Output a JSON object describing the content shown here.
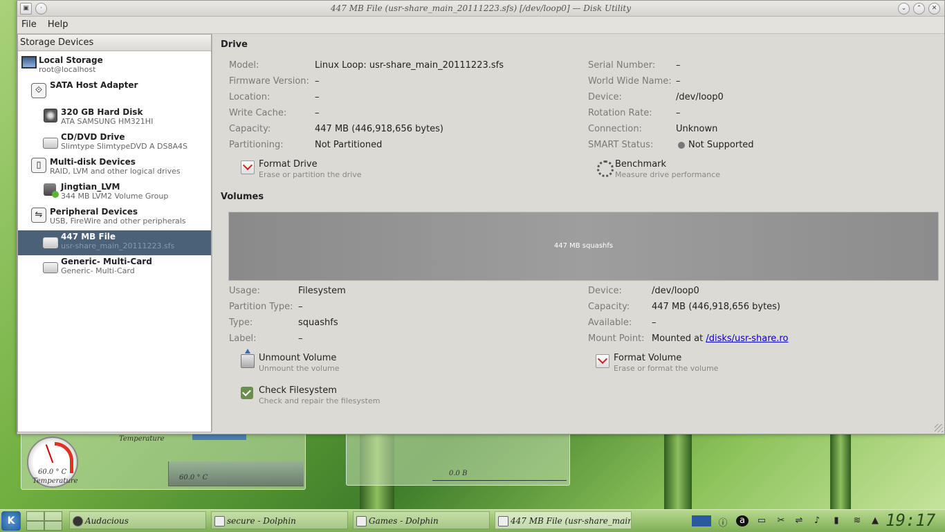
{
  "window": {
    "title": "447 MB File (usr-share_main_20111223.sfs) [/dev/loop0] — Disk Utility"
  },
  "menu": {
    "file": "File",
    "help": "Help"
  },
  "sidebar": {
    "header": "Storage Devices",
    "items": [
      {
        "title": "Local Storage",
        "sub": "root@localhost",
        "icon": "computer-icon"
      },
      {
        "title": "SATA Host Adapter",
        "sub": "",
        "icon": "sata-adapter-icon"
      },
      {
        "title": "320 GB Hard Disk",
        "sub": "ATA SAMSUNG HM321HI",
        "icon": "hard-disk-icon"
      },
      {
        "title": "CD/DVD Drive",
        "sub": "Slimtype SlimtypeDVD A DS8A4S",
        "icon": "optical-drive-icon"
      },
      {
        "title": "Multi-disk Devices",
        "sub": "RAID, LVM and other logical drives",
        "icon": "multidisk-icon"
      },
      {
        "title": "Jingtian_LVM",
        "sub": "344 MB LVM2 Volume Group",
        "icon": "lvm-icon"
      },
      {
        "title": "Peripheral Devices",
        "sub": "USB, FireWire and other peripherals",
        "icon": "usb-icon"
      },
      {
        "title": "447 MB File",
        "sub": "usr-share_main_20111223.sfs",
        "icon": "file-disk-icon",
        "selected": true
      },
      {
        "title": "Generic- Multi-Card",
        "sub": "Generic- Multi-Card",
        "icon": "card-reader-icon"
      }
    ]
  },
  "drive": {
    "heading": "Drive",
    "left": [
      {
        "label": "Model:",
        "value": "Linux Loop: usr-share_main_20111223.sfs"
      },
      {
        "label": "Firmware Version:",
        "value": "–"
      },
      {
        "label": "Location:",
        "value": "–"
      },
      {
        "label": "Write Cache:",
        "value": "–"
      },
      {
        "label": "Capacity:",
        "value": "447 MB (446,918,656 bytes)"
      },
      {
        "label": "Partitioning:",
        "value": "Not Partitioned"
      }
    ],
    "right": [
      {
        "label": "Serial Number:",
        "value": "–"
      },
      {
        "label": "World Wide Name:",
        "value": "–"
      },
      {
        "label": "Device:",
        "value": "/dev/loop0"
      },
      {
        "label": "Rotation Rate:",
        "value": "–"
      },
      {
        "label": "Connection:",
        "value": "Unknown"
      },
      {
        "label": "SMART Status:",
        "value": "Not Supported"
      }
    ],
    "format": {
      "title": "Format Drive",
      "sub": "Erase or partition the drive"
    },
    "benchmark": {
      "title": "Benchmark",
      "sub": "Measure drive performance"
    }
  },
  "volumes": {
    "heading": "Volumes",
    "bar_label": "447 MB squashfs",
    "left": [
      {
        "label": "Usage:",
        "value": "Filesystem"
      },
      {
        "label": "Partition Type:",
        "value": "–"
      },
      {
        "label": "Type:",
        "value": "squashfs"
      },
      {
        "label": "Label:",
        "value": "–"
      }
    ],
    "right": [
      {
        "label": "Device:",
        "value": "/dev/loop0"
      },
      {
        "label": "Capacity:",
        "value": "447 MB (446,918,656 bytes)"
      },
      {
        "label": "Available:",
        "value": "–"
      },
      {
        "label": "Mount Point:",
        "value_prefix": "Mounted at",
        "link": "/disks/usr-share.ro"
      }
    ],
    "unmount": {
      "title": "Unmount Volume",
      "sub": "Unmount the volume"
    },
    "format": {
      "title": "Format Volume",
      "sub": "Erase or format the volume"
    },
    "check": {
      "title": "Check Filesystem",
      "sub": "Check and repair the filesystem"
    }
  },
  "desktop": {
    "temp_widget_label": "Temperature",
    "gauge_value": "60.0 ° C",
    "gauge_label": "Temperature",
    "graph_value": "60.0 ° C",
    "mem_label": "0.0 B"
  },
  "taskbar": {
    "tasks": [
      {
        "label": "Audacious"
      },
      {
        "label": "secure - Dolphin"
      },
      {
        "label": "Games - Dolphin"
      },
      {
        "label": "447 MB File (usr-share_main",
        "active": true
      }
    ],
    "clock": "19:17"
  }
}
